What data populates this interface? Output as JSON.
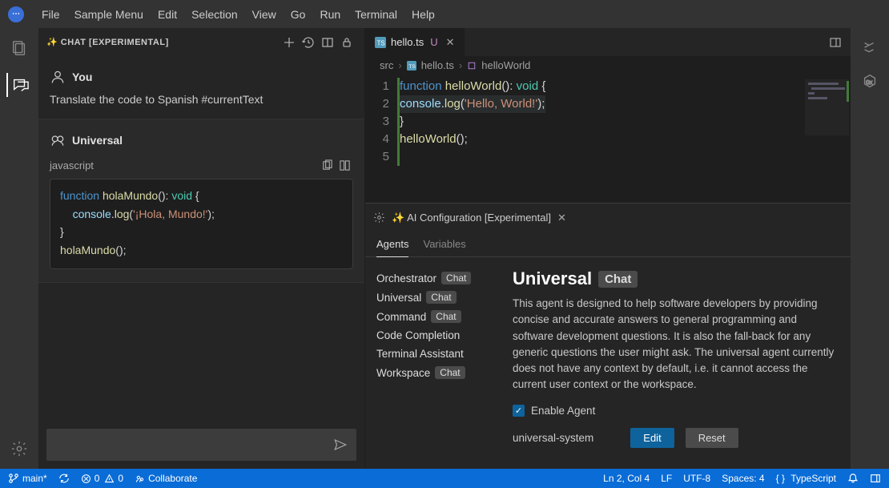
{
  "menu": {
    "items": [
      "File",
      "Sample Menu",
      "Edit",
      "Selection",
      "View",
      "Go",
      "Run",
      "Terminal",
      "Help"
    ]
  },
  "activity": {
    "icons": [
      "files",
      "chat",
      "gear"
    ]
  },
  "chat": {
    "title": "✨ CHAT [EXPERIMENTAL]",
    "user_label": "You",
    "user_msg": "Translate the code to Spanish #currentText",
    "agent_label": "Universal",
    "code_lang": "javascript",
    "code_lines": [
      {
        "t": "kw",
        "v": "function "
      },
      {
        "t": "fn",
        "v": "holaMundo"
      },
      {
        "t": "pun",
        "v": "(): "
      },
      {
        "t": "ty",
        "v": "void"
      },
      {
        "t": "pun",
        "v": " {"
      },
      {
        "t": "nl"
      },
      {
        "t": "pun",
        "v": "    "
      },
      {
        "t": "id",
        "v": "console"
      },
      {
        "t": "pun",
        "v": "."
      },
      {
        "t": "fn",
        "v": "log"
      },
      {
        "t": "pun",
        "v": "("
      },
      {
        "t": "str",
        "v": "'¡Hola, Mundo!'"
      },
      {
        "t": "pun",
        "v": ");"
      },
      {
        "t": "nl"
      },
      {
        "t": "pun",
        "v": "}"
      },
      {
        "t": "nl"
      },
      {
        "t": "fn",
        "v": "holaMundo"
      },
      {
        "t": "pun",
        "v": "();"
      }
    ]
  },
  "editor": {
    "tab_name": "hello.ts",
    "tab_mod": "U",
    "breadcrumb": [
      "src",
      "hello.ts",
      "helloWorld"
    ],
    "line_nums": [
      "1",
      "2",
      "3",
      "4",
      "5"
    ],
    "lines": [
      [
        {
          "t": "kw",
          "v": "function "
        },
        {
          "t": "fn",
          "v": "helloWorld"
        },
        {
          "t": "pun",
          "v": "(): "
        },
        {
          "t": "ty",
          "v": "void"
        },
        {
          "t": "pun",
          "v": " {"
        }
      ],
      [
        {
          "t": "pun",
          "v": "    "
        },
        {
          "t": "id",
          "v": "console"
        },
        {
          "t": "pun",
          "v": "."
        },
        {
          "t": "fn",
          "v": "log"
        },
        {
          "t": "pun",
          "v": "("
        },
        {
          "t": "str",
          "v": "'Hello, World!'"
        },
        {
          "t": "pun",
          "v": ");"
        }
      ],
      [
        {
          "t": "pun",
          "v": "}"
        }
      ],
      [
        {
          "t": "fn",
          "v": "helloWorld"
        },
        {
          "t": "pun",
          "v": "();"
        }
      ],
      []
    ]
  },
  "ai": {
    "panel_title": "✨ AI Configuration [Experimental]",
    "tabs": [
      "Agents",
      "Variables"
    ],
    "agents": [
      {
        "name": "Orchestrator",
        "badge": "Chat"
      },
      {
        "name": "Universal",
        "badge": "Chat"
      },
      {
        "name": "Command",
        "badge": "Chat"
      },
      {
        "name": "Code Completion",
        "badge": ""
      },
      {
        "name": "Terminal Assistant",
        "badge": ""
      },
      {
        "name": "Workspace",
        "badge": "Chat"
      }
    ],
    "detail_title": "Universal",
    "detail_badge": "Chat",
    "detail_desc": "This agent is designed to help software developers by providing concise and accurate answers to general programming and software development questions. It is also the fall-back for any generic questions the user might ask. The universal agent currently does not have any context by default, i.e. it cannot access the current user context or the workspace.",
    "enable_label": "Enable Agent",
    "system_label": "universal-system",
    "edit_btn": "Edit",
    "reset_btn": "Reset"
  },
  "status": {
    "branch": "main*",
    "errors": "0",
    "warnings": "0",
    "collab": "Collaborate",
    "pos": "Ln 2, Col 4",
    "eol": "LF",
    "enc": "UTF-8",
    "spaces": "Spaces: 4",
    "lang": "TypeScript"
  }
}
